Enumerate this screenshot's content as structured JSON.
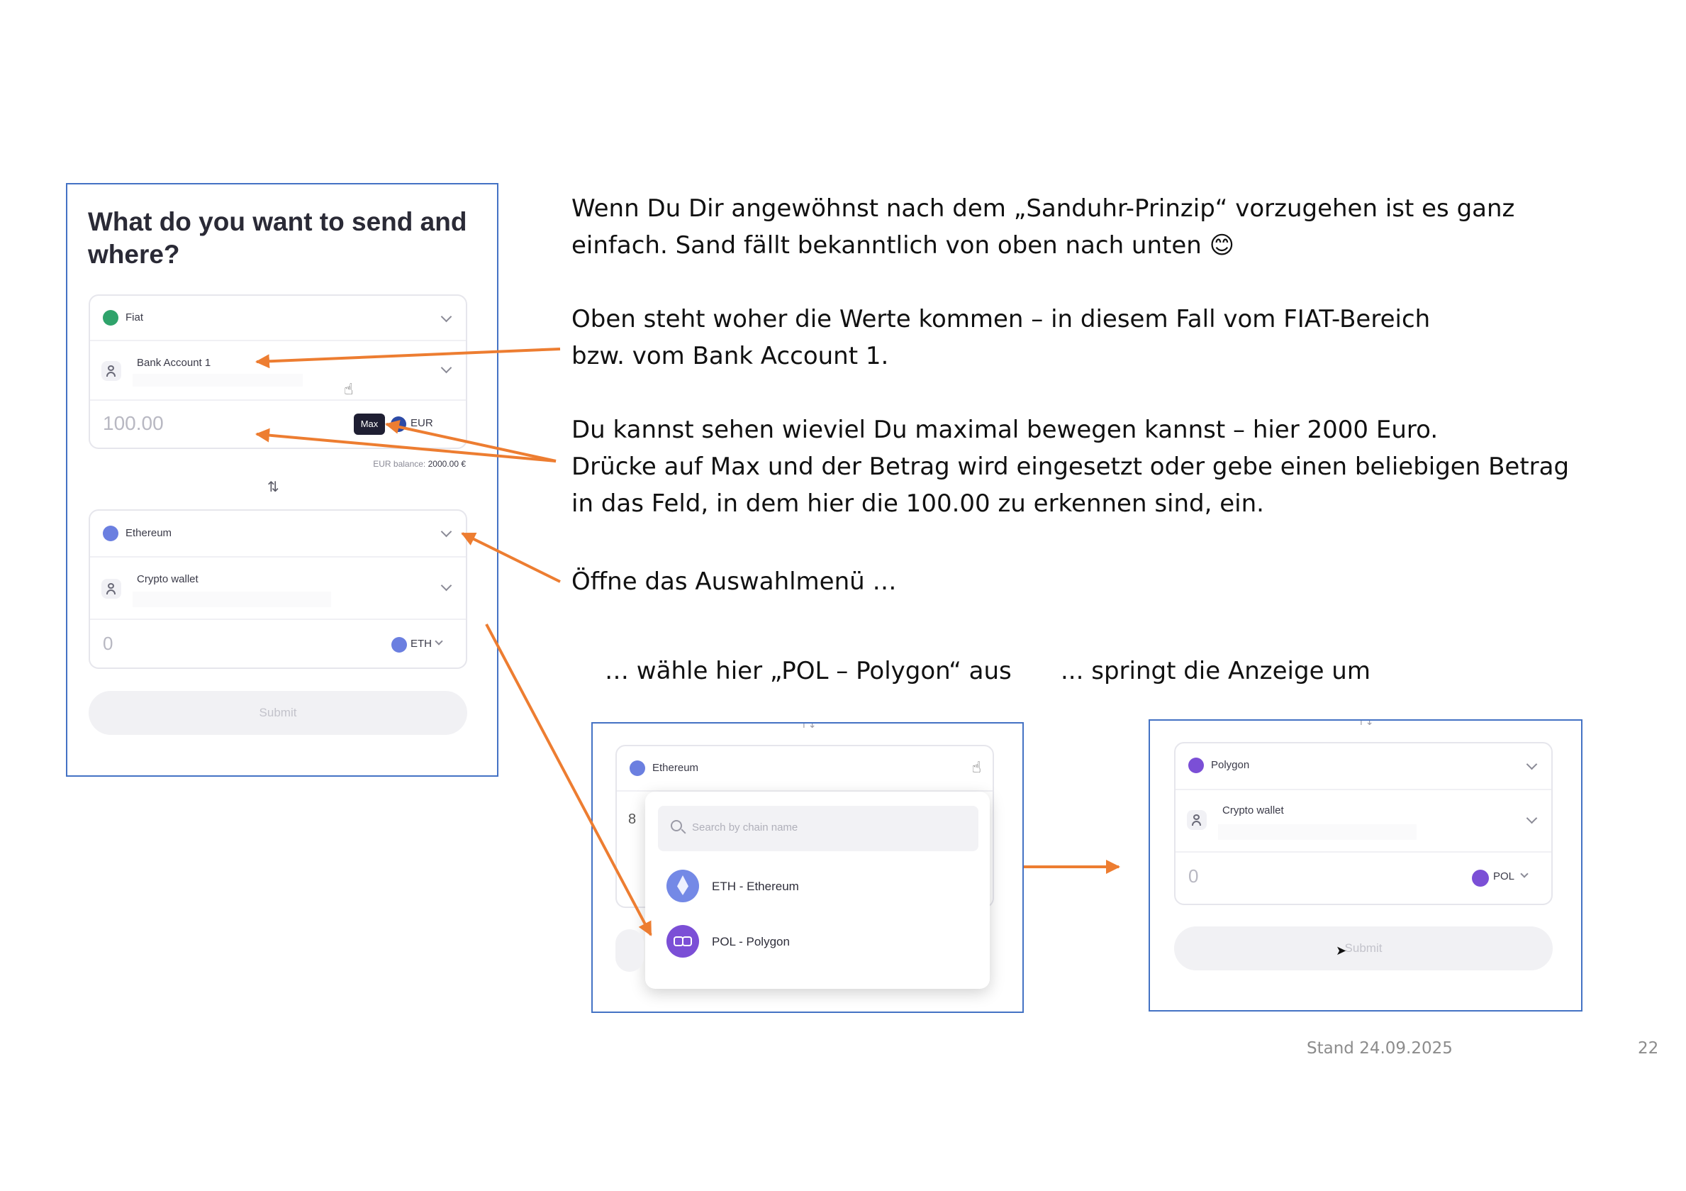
{
  "left_panel": {
    "title_line1": "What do you want to send and",
    "title_line2": "where?",
    "from": {
      "network_label": "Fiat",
      "account_label": "Bank Account 1",
      "amount_value": "100.00",
      "max_label": "Max",
      "currency_label": "EUR",
      "balance_label": "EUR balance:",
      "balance_value": "2000.00 €"
    },
    "swap_symbol": "⇅",
    "to": {
      "network_label": "Ethereum",
      "account_label": "Crypto wallet",
      "amount_value": "0",
      "currency_label": "ETH"
    },
    "submit_label": "Submit"
  },
  "middle_panel": {
    "network_label": "Ethereum",
    "search_placeholder": "Search by chain name",
    "options": [
      {
        "label": "ETH - Ethereum",
        "icon": "ethereum-icon"
      },
      {
        "label": "POL - Polygon",
        "icon": "polygon-icon"
      }
    ]
  },
  "right_panel": {
    "network_label": "Polygon",
    "account_label": "Crypto wallet",
    "amount_value": "0",
    "currency_label": "POL",
    "submit_label": "Submit"
  },
  "text": {
    "p1_line1": "Wenn Du Dir angewöhnst nach dem „Sanduhr-Prinzip“ vorzugehen ist es ganz",
    "p1_line2": "einfach. Sand fällt bekanntlich von oben nach unten",
    "emoji": "😊",
    "p2_line1": "Oben steht woher die Werte kommen – in diesem Fall vom FIAT-Bereich",
    "p2_line2": "bzw. vom Bank Account 1.",
    "p3_line1": "Du kannst sehen wieviel Du maximal bewegen kannst – hier 2000 Euro.",
    "p3_line2": "Drücke auf Max und der Betrag wird eingesetzt oder gebe einen beliebigen Betrag",
    "p3_line3": "in das Feld, in dem hier die 100.00 zu erkennen sind, ein.",
    "p4": "Öffne das Auswahlmenü …",
    "caption_left": "… wähle hier „POL – Polygon“ aus",
    "caption_right": "... springt die Anzeige um"
  },
  "footer": {
    "date": "Stand 24.09.2025",
    "page": "22"
  },
  "colors": {
    "arrow": "#ed7d31",
    "frame": "#4472c4",
    "polygon": "#7b4fd6",
    "ethereum": "#6b7fe0",
    "fiat": "#2fa36b"
  }
}
